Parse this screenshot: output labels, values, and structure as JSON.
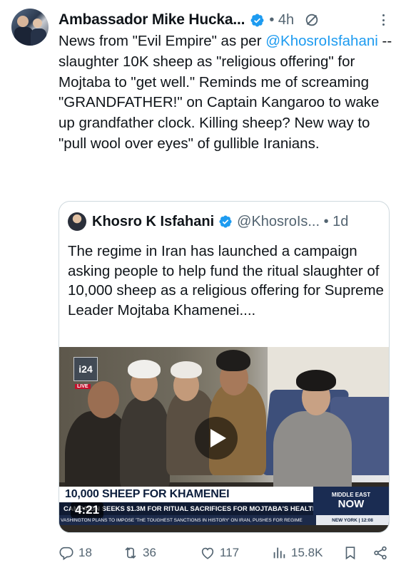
{
  "post": {
    "author_name": "Ambassador Mike Hucka...",
    "time": "• 4h",
    "text_before_mention": "News from \"Evil Empire\" as per ",
    "mention": "@KhosroIsfahani",
    "text_after_mention": " --slaughter 10K sheep as \"religious offering\" for Mojtaba to \"get well.\"  Reminds me of screaming \"GRANDFATHER!\" on Captain Kangaroo to wake up grandfather clock. Killing sheep? New way to \"pull wool over eyes\" of gullible Iranians."
  },
  "quote": {
    "author_name": "Khosro K Isfahani",
    "handle_time": "@KhosroIs... • 1d",
    "text": "The regime in Iran has launched a campaign asking people to help fund the ritual slaughter of 10,000 sheep as a religious offering for Supreme Leader Mojtaba Khamenei....",
    "video": {
      "channel_logo": "i24",
      "live_label": "LIVE",
      "headline": "10,000 SHEEP FOR KHAMENEI",
      "subheadline": "CAMPAIGN SEEKS $1.3M FOR RITUAL SACRIFICES FOR MOJTABA'S HEALTH",
      "ticker": "VASHINGTON PLANS TO IMPOSE 'THE TOUGHEST SANCTIONS IN HISTORY' ON IRAN, PUSHES FOR REGIME",
      "region_label_1": "MIDDLE EAST",
      "region_label_2": "NOW",
      "location_time": "NEW YORK  |  12:08",
      "duration": "4:21"
    }
  },
  "actions": {
    "replies": "18",
    "reposts": "36",
    "likes": "117",
    "views": "15.8K"
  },
  "colors": {
    "accent": "#1d9bf0",
    "text": "#0f1419",
    "muted": "#536471",
    "border": "#cfd9de"
  }
}
